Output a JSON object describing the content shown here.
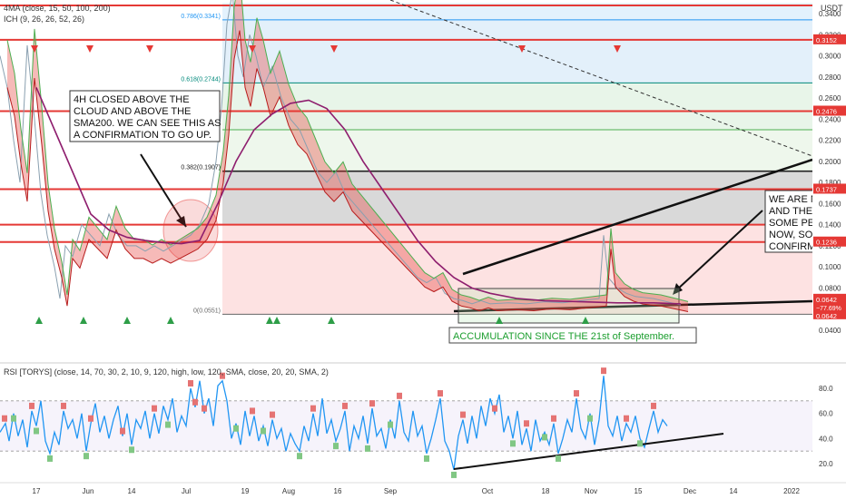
{
  "header": {
    "indicator_ma": "4MA (close, 15, 50, 100, 200)",
    "indicator_ich": "ICH (9, 26, 26, 52, 26)",
    "quote": "USDT",
    "rsi_indicator": "RSI [TORYS] (close, 14, 70, 30, 2, 10, 9, 120, high, low, 120, SMA, close, 20, 20, SMA, 2)"
  },
  "colors": {
    "red_line": "#e53935",
    "green_marker": "#2e9e48",
    "red_marker": "#e53935",
    "rsi_line": "#2196f3",
    "fib_blue": "#2196f3",
    "fib_green": "#4caf50",
    "fib_teal": "#00897b",
    "fib_gray": "#9e9e9e"
  },
  "annotations": {
    "left_box": [
      "4H CLOSED ABOVE THE",
      "CLOUD AND ABOVE THE",
      "SMA200. WE CAN SEE THIS AS",
      "A CONFIRMATION TO GO UP."
    ],
    "right_box": [
      "WE ARE N",
      "AND THE",
      "SOME PE",
      "NOW, SO",
      "CONFIRM"
    ],
    "accumulation": "ACCUMULATION SINCE THE 21st of September."
  },
  "chart_data": [
    {
      "type": "line",
      "title": "",
      "quote": "USDT",
      "y_ticks": [
        "0.3400",
        "0.3200",
        "0.3000",
        "0.2800",
        "0.2600",
        "0.2400",
        "0.2200",
        "0.2000",
        "0.1800",
        "0.1600",
        "0.1400",
        "0.1200",
        "0.1000",
        "0.0800",
        "0.0600",
        "0.0400"
      ],
      "ylim": [
        0.03,
        0.35
      ],
      "x_ticks": [
        "17",
        "Jun",
        "14",
        "Jul",
        "19",
        "Aug",
        "16",
        "Sep",
        "Oct",
        "18",
        "Nov",
        "15",
        "Dec",
        "14",
        "2022"
      ],
      "horizontal_levels": [
        {
          "label": "0.3152",
          "value": 0.3152
        },
        {
          "label": "0.2476",
          "value": 0.2476
        },
        {
          "label": "0.1737",
          "value": 0.1737
        },
        {
          "label": "0.1236",
          "value": 0.1236
        }
      ],
      "fib_levels": [
        {
          "label": "0.786(0.3341)",
          "value": 0.3341
        },
        {
          "label": "0.618(0.2744)",
          "value": 0.2744
        },
        {
          "label": "0.382(0.1907)",
          "value": 0.1907
        },
        {
          "label": "0(0.0551)",
          "value": 0.0551
        }
      ],
      "current_price": {
        "label": "0.0642",
        "change": "−77.69%",
        "value": 0.0642
      },
      "price_path": [
        [
          0,
          0.3
        ],
        [
          8,
          0.27
        ],
        [
          15,
          0.22
        ],
        [
          22,
          0.18
        ],
        [
          30,
          0.31
        ],
        [
          38,
          0.24
        ],
        [
          45,
          0.17
        ],
        [
          52,
          0.13
        ],
        [
          60,
          0.1
        ],
        [
          66,
          0.07
        ],
        [
          72,
          0.12
        ],
        [
          80,
          0.11
        ],
        [
          90,
          0.14
        ],
        [
          100,
          0.13
        ],
        [
          110,
          0.12
        ],
        [
          120,
          0.15
        ],
        [
          130,
          0.13
        ],
        [
          140,
          0.12
        ],
        [
          150,
          0.12
        ],
        [
          160,
          0.115
        ],
        [
          170,
          0.12
        ],
        [
          180,
          0.115
        ],
        [
          190,
          0.12
        ],
        [
          200,
          0.125
        ],
        [
          210,
          0.13
        ],
        [
          220,
          0.14
        ],
        [
          230,
          0.16
        ],
        [
          238,
          0.2
        ],
        [
          244,
          0.25
        ],
        [
          250,
          0.33
        ],
        [
          256,
          0.36
        ],
        [
          262,
          0.3
        ],
        [
          268,
          0.28
        ],
        [
          275,
          0.32
        ],
        [
          282,
          0.3
        ],
        [
          290,
          0.27
        ],
        [
          300,
          0.29
        ],
        [
          310,
          0.26
        ],
        [
          320,
          0.24
        ],
        [
          330,
          0.23
        ],
        [
          340,
          0.21
        ],
        [
          350,
          0.19
        ],
        [
          360,
          0.18
        ],
        [
          370,
          0.19
        ],
        [
          380,
          0.17
        ],
        [
          390,
          0.16
        ],
        [
          400,
          0.15
        ],
        [
          410,
          0.14
        ],
        [
          420,
          0.13
        ],
        [
          430,
          0.12
        ],
        [
          440,
          0.11
        ],
        [
          450,
          0.1
        ],
        [
          460,
          0.09
        ],
        [
          470,
          0.085
        ],
        [
          480,
          0.09
        ],
        [
          490,
          0.075
        ],
        [
          500,
          0.07
        ],
        [
          510,
          0.068
        ],
        [
          520,
          0.065
        ],
        [
          530,
          0.068
        ],
        [
          540,
          0.065
        ],
        [
          560,
          0.066
        ],
        [
          580,
          0.065
        ],
        [
          600,
          0.067
        ],
        [
          620,
          0.066
        ],
        [
          640,
          0.068
        ],
        [
          660,
          0.07
        ],
        [
          665,
          0.13
        ],
        [
          670,
          0.09
        ],
        [
          680,
          0.08
        ],
        [
          690,
          0.075
        ],
        [
          700,
          0.072
        ],
        [
          720,
          0.07
        ],
        [
          740,
          0.066
        ],
        [
          750,
          0.064
        ]
      ],
      "sma_path": [
        [
          40,
          0.27
        ],
        [
          60,
          0.23
        ],
        [
          80,
          0.19
        ],
        [
          100,
          0.15
        ],
        [
          120,
          0.135
        ],
        [
          140,
          0.128
        ],
        [
          160,
          0.125
        ],
        [
          180,
          0.123
        ],
        [
          200,
          0.122
        ],
        [
          220,
          0.125
        ],
        [
          240,
          0.16
        ],
        [
          260,
          0.2
        ],
        [
          280,
          0.23
        ],
        [
          300,
          0.245
        ],
        [
          320,
          0.255
        ],
        [
          340,
          0.258
        ],
        [
          360,
          0.25
        ],
        [
          380,
          0.23
        ],
        [
          400,
          0.2
        ],
        [
          420,
          0.175
        ],
        [
          440,
          0.15
        ],
        [
          460,
          0.125
        ],
        [
          480,
          0.105
        ],
        [
          500,
          0.09
        ],
        [
          520,
          0.08
        ],
        [
          540,
          0.075
        ],
        [
          570,
          0.07
        ],
        [
          600,
          0.068
        ],
        [
          640,
          0.067
        ],
        [
          680,
          0.066
        ],
        [
          720,
          0.066
        ],
        [
          750,
          0.065
        ]
      ],
      "up_markers_x": [
        43,
        92,
        140,
        188,
        297,
        305,
        365,
        550,
        645
      ],
      "down_markers_x": [
        38,
        99,
        165,
        278,
        368,
        575,
        680
      ]
    },
    {
      "type": "line",
      "title": "RSI [TORYS]",
      "y_ticks": [
        "80.0",
        "60.0",
        "40.0",
        "20.0"
      ],
      "ylim": [
        10,
        95
      ],
      "upper_band": 70,
      "lower_band": 30,
      "rsi_path": [
        [
          0,
          45
        ],
        [
          6,
          52
        ],
        [
          10,
          38
        ],
        [
          15,
          60
        ],
        [
          20,
          42
        ],
        [
          25,
          55
        ],
        [
          30,
          33
        ],
        [
          35,
          62
        ],
        [
          40,
          50
        ],
        [
          45,
          70
        ],
        [
          50,
          38
        ],
        [
          55,
          28
        ],
        [
          60,
          45
        ],
        [
          65,
          35
        ],
        [
          70,
          62
        ],
        [
          75,
          48
        ],
        [
          80,
          55
        ],
        [
          85,
          40
        ],
        [
          90,
          60
        ],
        [
          95,
          30
        ],
        [
          100,
          52
        ],
        [
          105,
          68
        ],
        [
          110,
          45
        ],
        [
          115,
          58
        ],
        [
          120,
          40
        ],
        [
          125,
          55
        ],
        [
          130,
          66
        ],
        [
          135,
          42
        ],
        [
          140,
          60
        ],
        [
          145,
          35
        ],
        [
          150,
          55
        ],
        [
          155,
          48
        ],
        [
          160,
          62
        ],
        [
          165,
          40
        ],
        [
          170,
          60
        ],
        [
          175,
          44
        ],
        [
          180,
          66
        ],
        [
          185,
          55
        ],
        [
          190,
          72
        ],
        [
          195,
          45
        ],
        [
          200,
          58
        ],
        [
          205,
          50
        ],
        [
          210,
          80
        ],
        [
          215,
          65
        ],
        [
          220,
          86
        ],
        [
          225,
          60
        ],
        [
          230,
          72
        ],
        [
          235,
          50
        ],
        [
          240,
          82
        ],
        [
          245,
          86
        ],
        [
          250,
          70
        ],
        [
          255,
          40
        ],
        [
          260,
          52
        ],
        [
          265,
          35
        ],
        [
          270,
          62
        ],
        [
          275,
          42
        ],
        [
          280,
          58
        ],
        [
          285,
          38
        ],
        [
          290,
          50
        ],
        [
          295,
          34
        ],
        [
          300,
          55
        ],
        [
          305,
          40
        ],
        [
          310,
          48
        ],
        [
          315,
          30
        ],
        [
          320,
          44
        ],
        [
          325,
          36
        ],
        [
          330,
          30
        ],
        [
          335,
          50
        ],
        [
          340,
          38
        ],
        [
          345,
          60
        ],
        [
          350,
          42
        ],
        [
          355,
          72
        ],
        [
          360,
          44
        ],
        [
          365,
          55
        ],
        [
          370,
          38
        ],
        [
          375,
          48
        ],
        [
          380,
          62
        ],
        [
          385,
          30
        ],
        [
          390,
          50
        ],
        [
          395,
          40
        ],
        [
          400,
          58
        ],
        [
          405,
          36
        ],
        [
          410,
          64
        ],
        [
          415,
          42
        ],
        [
          420,
          48
        ],
        [
          425,
          32
        ],
        [
          430,
          55
        ],
        [
          435,
          40
        ],
        [
          440,
          70
        ],
        [
          445,
          45
        ],
        [
          450,
          38
        ],
        [
          455,
          62
        ],
        [
          460,
          42
        ],
        [
          465,
          50
        ],
        [
          470,
          28
        ],
        [
          475,
          40
        ],
        [
          480,
          55
        ],
        [
          485,
          72
        ],
        [
          490,
          38
        ],
        [
          495,
          30
        ],
        [
          500,
          15
        ],
        [
          505,
          42
        ],
        [
          510,
          55
        ],
        [
          515,
          36
        ],
        [
          520,
          58
        ],
        [
          525,
          40
        ],
        [
          530,
          66
        ],
        [
          535,
          50
        ],
        [
          540,
          72
        ],
        [
          545,
          60
        ],
        [
          550,
          75
        ],
        [
          555,
          45
        ],
        [
          560,
          58
        ],
        [
          565,
          40
        ],
        [
          570,
          62
        ],
        [
          575,
          35
        ],
        [
          580,
          48
        ],
        [
          585,
          30
        ],
        [
          590,
          55
        ],
        [
          595,
          38
        ],
        [
          600,
          45
        ],
        [
          605,
          35
        ],
        [
          610,
          52
        ],
        [
          615,
          28
        ],
        [
          620,
          40
        ],
        [
          625,
          55
        ],
        [
          630,
          45
        ],
        [
          635,
          72
        ],
        [
          640,
          48
        ],
        [
          645,
          40
        ],
        [
          650,
          60
        ],
        [
          655,
          35
        ],
        [
          660,
          55
        ],
        [
          665,
          90
        ],
        [
          670,
          50
        ],
        [
          675,
          42
        ],
        [
          680,
          58
        ],
        [
          685,
          38
        ],
        [
          690,
          52
        ],
        [
          695,
          45
        ],
        [
          700,
          58
        ],
        [
          705,
          40
        ],
        [
          710,
          33
        ],
        [
          715,
          48
        ],
        [
          720,
          62
        ],
        [
          725,
          45
        ],
        [
          730,
          55
        ],
        [
          735,
          50
        ]
      ],
      "red_markers_x": [
        5,
        35,
        70,
        100,
        135,
        170,
        210,
        215,
        225,
        245,
        278,
        300,
        345,
        380,
        410,
        440,
        485,
        510,
        545,
        580,
        610,
        635,
        665,
        690,
        720
      ],
      "green_markers_x": [
        15,
        40,
        55,
        95,
        145,
        185,
        260,
        290,
        330,
        370,
        405,
        430,
        470,
        500,
        565,
        600,
        615,
        650,
        705
      ]
    }
  ]
}
